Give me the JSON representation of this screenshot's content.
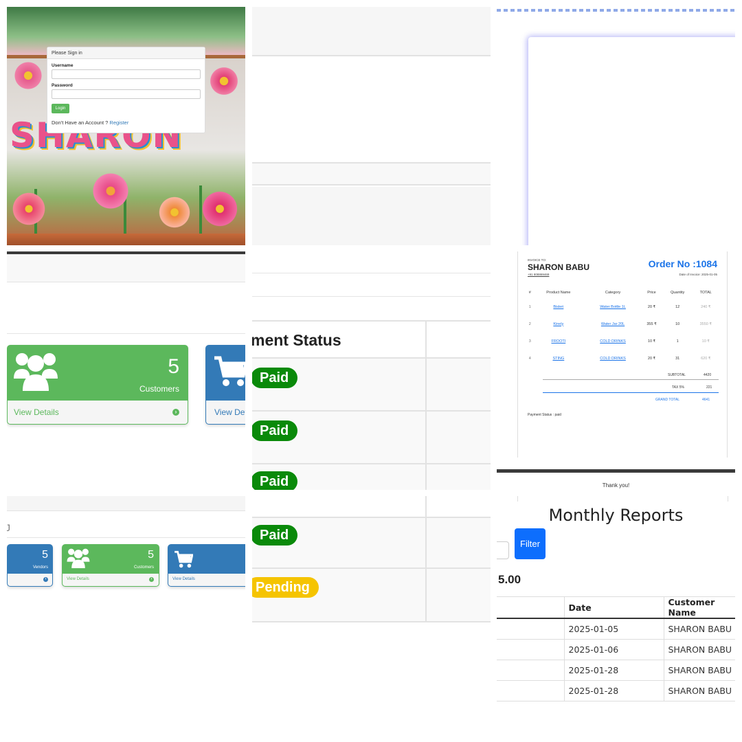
{
  "login": {
    "panel_title": "Please Sign in",
    "username_label": "Username",
    "username_value": "",
    "password_label": "Password",
    "password_value": "",
    "login_button": "Login",
    "no_account_text": "Don't Have an Account ?",
    "register_link": "Register",
    "background_word": "SHARON"
  },
  "dashboard_zoom": {
    "customers_card": {
      "count": "5",
      "label": "Customers",
      "footer_link": "View Details",
      "icon": "users-icon",
      "color": "#5cb85c"
    },
    "orders_card": {
      "footer_link": "View Details",
      "icon": "cart-icon",
      "color": "#337ab7"
    }
  },
  "payment": {
    "header": "ment Status",
    "statuses": [
      "Paid",
      "Paid",
      "Paid",
      "Paid",
      "Pending"
    ]
  },
  "invoice": {
    "invoice_to_label": "INVOICE TO:",
    "customer_name": "SHARON BABU",
    "phone": "+91 808869469",
    "order_no": "Order No :1084",
    "invoice_date": "Date of Invoice: 2025-01-05",
    "columns": [
      "#",
      "Product Name",
      "Category",
      "Price",
      "Quantity",
      "TOTAL"
    ],
    "rows": [
      [
        "1",
        "Bisleri",
        "Water Bottle 1L",
        "20 ₹",
        "12",
        "240 ₹"
      ],
      [
        "2",
        "Kinely",
        "Water Jar 20L",
        "355 ₹",
        "10",
        "3550 ₹"
      ],
      [
        "3",
        "FROOTI",
        "COLD DRINKS",
        "10 ₹",
        "1",
        "10 ₹"
      ],
      [
        "4",
        "STING",
        "COLD DRINKS",
        "20 ₹",
        "31",
        "620 ₹"
      ]
    ],
    "subtotal_label": "SUBTOTAL",
    "subtotal": "4420",
    "tax_label": "TAX 5%",
    "tax": "221",
    "grand_total_label": "GRAND TOTAL",
    "grand_total": "4641",
    "payment_status": "Payment Status : paid",
    "thanks": "Thank you!"
  },
  "dashboard_small": {
    "vendors_card": {
      "count": "5",
      "label": "Vendors",
      "color": "#337ab7"
    },
    "customers_card": {
      "count": "5",
      "label": "Customers",
      "footer_link": "View Details",
      "color": "#5cb85c"
    },
    "orders_card": {
      "footer_link": "View Details",
      "color": "#337ab7"
    },
    "section_heading_fragment": "J"
  },
  "reports": {
    "title": "Monthly Reports",
    "filter_button": "Filter",
    "total_fragment": "5.00",
    "columns": [
      "Date",
      "Customer Name"
    ],
    "rows": [
      [
        "2025-01-05",
        "SHARON BABU"
      ],
      [
        "2025-01-06",
        "SHARON BABU"
      ],
      [
        "2025-01-28",
        "SHARON BABU"
      ],
      [
        "2025-01-28",
        "SHARON BABU"
      ]
    ]
  }
}
